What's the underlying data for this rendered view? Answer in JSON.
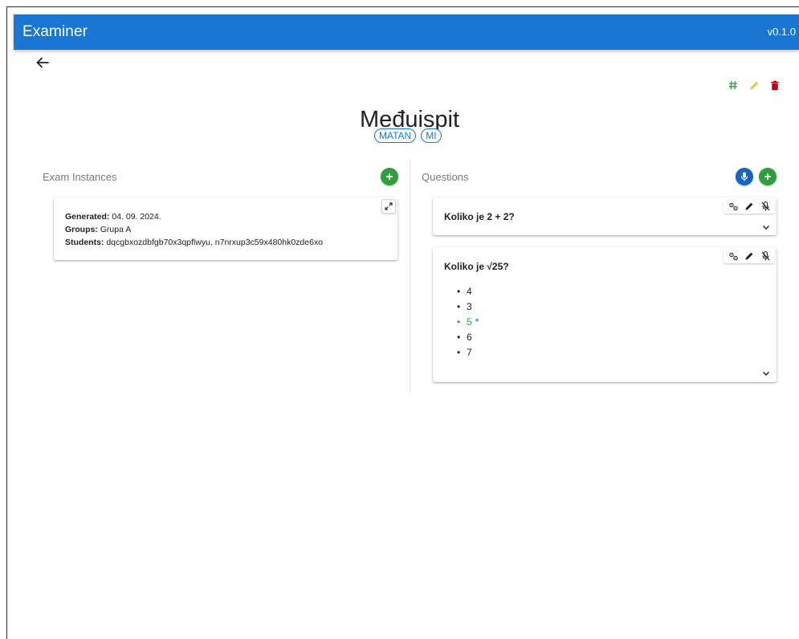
{
  "appbar": {
    "title": "Examiner",
    "version": "v0.1.0"
  },
  "exam": {
    "title": "Međuispit",
    "tags": [
      "MATAN",
      "MI"
    ]
  },
  "instances_section": {
    "label": "Exam Instances",
    "instances": [
      {
        "generated_label": "Generated:",
        "generated_value": " 04. 09. 2024.",
        "groups_label": "Groups:",
        "groups_value": " Grupa A",
        "students_label": "Students:",
        "students_value": " dqcgbxozdbfgb70x3qpflwyu, n7nrxup3c59x480hk0zde6xo"
      }
    ]
  },
  "questions_section": {
    "label": "Questions",
    "questions": [
      {
        "text": "Koliko je 2 + 2?"
      },
      {
        "text": "Koliko je √25?",
        "answers": [
          {
            "text": "4",
            "correct": false
          },
          {
            "text": "3",
            "correct": false
          },
          {
            "text": "5",
            "correct": true
          },
          {
            "text": "6",
            "correct": false
          },
          {
            "text": "7",
            "correct": false
          }
        ],
        "correct_marker": "*"
      }
    ]
  },
  "colors": {
    "primary": "#1976d2",
    "success": "#2e9e3e",
    "warning": "#f2c037",
    "danger": "#c10015"
  },
  "icons": {
    "back": "arrow-left-icon",
    "hash": "hash-icon",
    "edit": "pencil-icon",
    "delete": "trash-icon",
    "add": "plus-icon",
    "expand": "expand-icon",
    "settings": "cogs-icon",
    "microphone_off": "microphone-off-icon",
    "chevron": "chevron-down-icon"
  }
}
